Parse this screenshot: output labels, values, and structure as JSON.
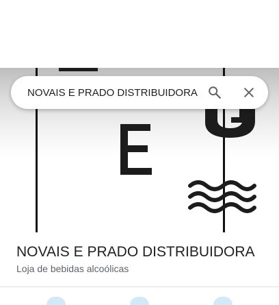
{
  "search": {
    "query": "NOVAIS E PRADO DISTRIBUIDORA",
    "search_icon": "search-icon",
    "close_icon": "close-icon"
  },
  "place": {
    "name": "NOVAIS E PRADO DISTRIBUIDORA",
    "category": "Loja de bebidas alcoólicas"
  },
  "colors": {
    "title": "#202124",
    "secondary": "#5f6368",
    "action_circle": "#d2e9f7"
  }
}
